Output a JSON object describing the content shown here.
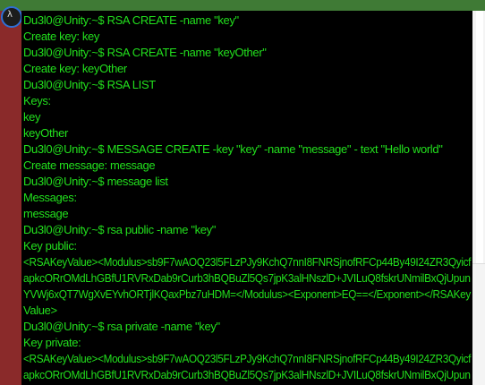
{
  "colors": {
    "terminal_bg": "#000000",
    "terminal_text": "#22e01d",
    "top_bar": "#3f7a35",
    "left_strip": "#8a2a2a",
    "avatar_ring": "#2f6fd6"
  },
  "avatar": {
    "glyph": "λ",
    "icon": "app-icon"
  },
  "terminal": {
    "lines": [
      "Du3l0@Unity:~$ RSA CREATE -name \"key\"",
      "Create key: key",
      "Du3l0@Unity:~$ RSA CREATE -name \"keyOther\"",
      "Create key: keyOther",
      "Du3l0@Unity:~$ RSA LIST",
      "Keys:",
      "key",
      "keyOther",
      "Du3l0@Unity:~$ MESSAGE CREATE -key \"key\" -name \"message\" - text \"Hello world\"",
      "Create message: message",
      "Du3l0@Unity:~$ message list",
      "Messages:",
      "message",
      "Du3l0@Unity:~$ rsa public -name \"key\"",
      " Key public:",
      "<RSAKeyValue><Modulus>sb9F7wAOQ23l5FLzPJy9KchQ7nnI8FNRSjnofRFCp44By49I24ZR3Qyicf",
      "apkcORrOMdLhGBfU1RVRxDab9rCurb3hBQBuZl5Qs7jpK3alHNszlD+JVILuQ8fskrUNmilBxQjUpun",
      "YVWj6xQT7WgXvEYvhORTjlKQaxPbz7uHDM=</Modulus><Exponent>EQ==</Exponent></RSAKey",
      "Value>",
      "Du3l0@Unity:~$ rsa private -name \"key\"",
      " Key private:",
      "<RSAKeyValue><Modulus>sb9F7wAOQ23l5FLzPJy9KchQ7nnI8FNRSjnofRFCp44By49I24ZR3Qyicf",
      "apkcORrOMdLhGBfU1RVRxDab9rCurb3hBQBuZl5Qs7jpK3alHNszlD+JVILuQ8fskrUNmilBxQjUpun"
    ]
  }
}
